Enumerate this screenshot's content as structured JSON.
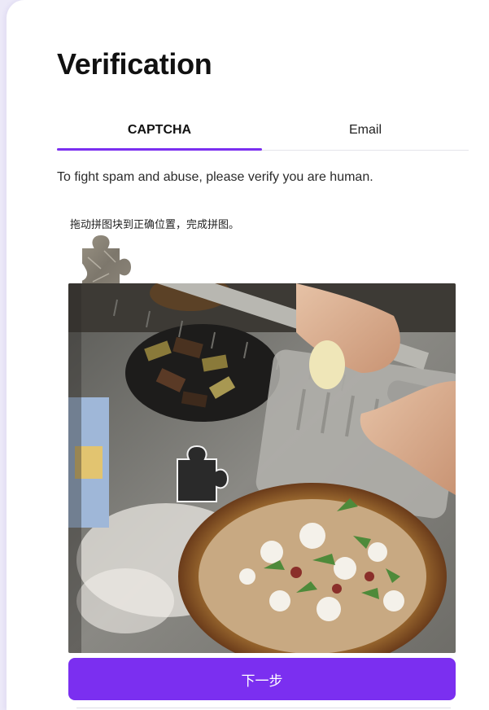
{
  "page": {
    "title": "Verification"
  },
  "tabs": [
    {
      "label": "CAPTCHA",
      "active": true
    },
    {
      "label": "Email",
      "active": false
    }
  ],
  "description": "To fight spam and abuse, please verify you are human.",
  "captcha": {
    "instruction": "拖动拼图块到正确位置，完成拼图。",
    "piece_icon": "puzzle-piece-icon",
    "slot_icon": "puzzle-slot-icon"
  },
  "actions": {
    "next_label": "下一步"
  },
  "colors": {
    "accent": "#7b2ff0",
    "background": "#ece9f8",
    "card": "#ffffff",
    "text": "#111111"
  }
}
